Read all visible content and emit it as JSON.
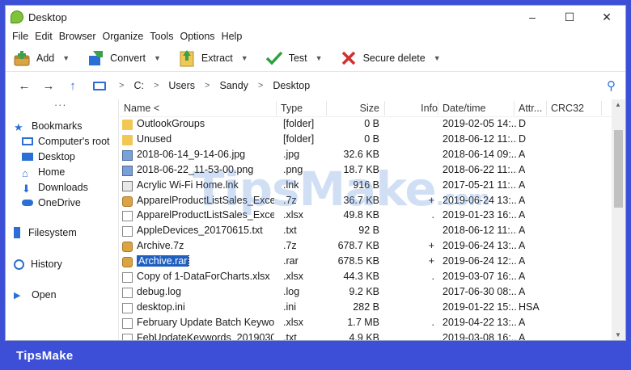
{
  "window": {
    "title": "Desktop"
  },
  "menu": [
    "File",
    "Edit",
    "Browser",
    "Organize",
    "Tools",
    "Options",
    "Help"
  ],
  "toolbar": [
    {
      "label": "Add",
      "icon": "add-archive-icon"
    },
    {
      "label": "Convert",
      "icon": "convert-icon"
    },
    {
      "label": "Extract",
      "icon": "extract-icon"
    },
    {
      "label": "Test",
      "icon": "checkmark-icon"
    },
    {
      "label": "Secure delete",
      "icon": "red-x-icon"
    }
  ],
  "address": {
    "path": [
      "C:",
      "Users",
      "Sandy",
      "Desktop"
    ]
  },
  "sidebar": {
    "ellipsis": "···",
    "bookmarks": "Bookmarks",
    "bookmark_items": [
      "Computer's root",
      "Desktop",
      "Home",
      "Downloads",
      "OneDrive"
    ],
    "filesystem": "Filesystem",
    "history": "History",
    "open": "Open"
  },
  "columns": {
    "name": "Name <",
    "type": "Type",
    "size": "Size",
    "info": "Info",
    "datetime": "Date/time",
    "attr": "Attr...",
    "crc": "CRC32"
  },
  "files": [
    {
      "name": "OutlookGroups",
      "type": "[folder]",
      "size": "0 B",
      "info": "",
      "date": "2019-02-05 14:...",
      "attr": "D",
      "icon": "folder"
    },
    {
      "name": "Unused",
      "type": "[folder]",
      "size": "0 B",
      "info": "",
      "date": "2018-06-12 11:...",
      "attr": "D",
      "icon": "folder"
    },
    {
      "name": "2018-06-14_9-14-06.jpg",
      "type": ".jpg",
      "size": "32.6 KB",
      "info": "",
      "date": "2018-06-14 09:...",
      "attr": "A",
      "icon": "img"
    },
    {
      "name": "2018-06-22_11-53-00.png",
      "type": ".png",
      "size": "18.7 KB",
      "info": "",
      "date": "2018-06-22 11:...",
      "attr": "A",
      "icon": "img"
    },
    {
      "name": "Acrylic Wi-Fi Home.lnk",
      "type": ".lnk",
      "size": "916 B",
      "info": "",
      "date": "2017-05-21 11:...",
      "attr": "A",
      "icon": "lnk"
    },
    {
      "name": "ApparelProductListSales_Excel...",
      "type": ".7z",
      "size": "36.7 KB",
      "info": "+",
      "date": "2019-06-24 13:...",
      "attr": "A",
      "icon": "arch"
    },
    {
      "name": "ApparelProductListSales_Excel...",
      "type": ".xlsx",
      "size": "49.8 KB",
      "info": ".",
      "date": "2019-01-23 16:...",
      "attr": "A",
      "icon": "doc"
    },
    {
      "name": "AppleDevices_20170615.txt",
      "type": ".txt",
      "size": "92 B",
      "info": "",
      "date": "2018-06-12 11:...",
      "attr": "A",
      "icon": "doc"
    },
    {
      "name": "Archive.7z",
      "type": ".7z",
      "size": "678.7 KB",
      "info": "+",
      "date": "2019-06-24 13:...",
      "attr": "A",
      "icon": "arch"
    },
    {
      "name": "Archive.rar",
      "type": ".rar",
      "size": "678.5 KB",
      "info": "+",
      "date": "2019-06-24 12:...",
      "attr": "A",
      "icon": "arch",
      "selected": true
    },
    {
      "name": "Copy of 1-DataForCharts.xlsx",
      "type": ".xlsx",
      "size": "44.3 KB",
      "info": ".",
      "date": "2019-03-07 16:...",
      "attr": "A",
      "icon": "doc"
    },
    {
      "name": "debug.log",
      "type": ".log",
      "size": "9.2 KB",
      "info": "",
      "date": "2017-06-30 08:...",
      "attr": "A",
      "icon": "doc"
    },
    {
      "name": "desktop.ini",
      "type": ".ini",
      "size": "282 B",
      "info": "",
      "date": "2019-01-22 15:...",
      "attr": "HSA",
      "icon": "doc"
    },
    {
      "name": "February Update Batch Keywo...",
      "type": ".xlsx",
      "size": "1.7 MB",
      "info": ".",
      "date": "2019-04-22 13:...",
      "attr": "A",
      "icon": "doc"
    },
    {
      "name": "FebUpdateKeywords_2019030...",
      "type": ".txt",
      "size": "4.9 KB",
      "info": "",
      "date": "2019-03-08 16:...",
      "attr": "A",
      "icon": "doc"
    }
  ],
  "watermark": {
    "main": "TipsMake",
    "suffix": ".com"
  },
  "footer": {
    "brand": "TipsMake"
  }
}
